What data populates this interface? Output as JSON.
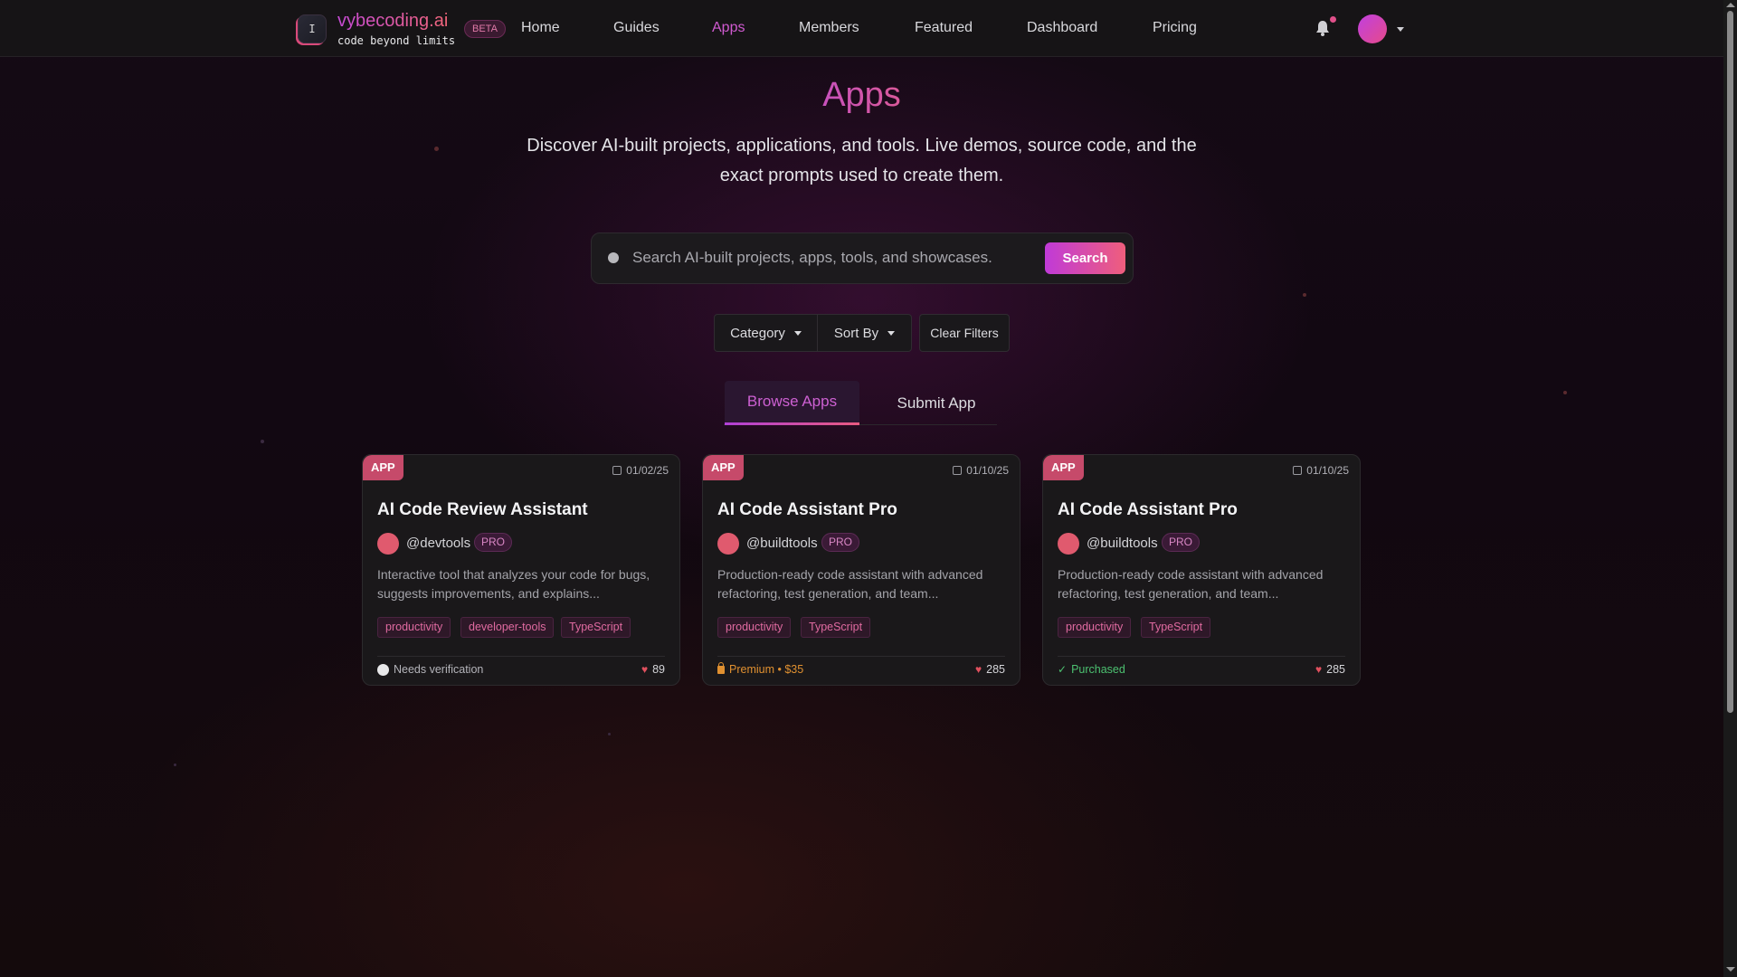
{
  "brand": {
    "name": "vybecoding.ai",
    "tagline": "code beyond limits",
    "badge": "BETA",
    "logo_glyph": "I"
  },
  "nav": {
    "links": [
      "Home",
      "Guides",
      "Apps",
      "Members",
      "Featured",
      "Dashboard",
      "Pricing"
    ],
    "active": "Apps",
    "icons": [
      "bell-icon",
      "user-avatar",
      "caret-down-icon"
    ]
  },
  "page": {
    "title": "Apps",
    "description": "Discover AI-built projects, applications, and tools. Live demos, source code, and the exact prompts used to create them."
  },
  "search": {
    "placeholder": "Search AI-built projects, apps, tools, and showcases.",
    "button": "Search"
  },
  "filters": {
    "category": "Category",
    "sort": "Sort By",
    "clear": "Clear Filters"
  },
  "tabs": {
    "browse": "Browse Apps",
    "submit": "Submit App",
    "active": "Browse Apps"
  },
  "cards": [
    {
      "badge": "APP",
      "date": "01/02/25",
      "title": "AI Code Review Assistant",
      "author": "@devtools",
      "tier": "PRO",
      "description": "Interactive tool that analyzes your code for bugs, suggests improvements, and explains...",
      "tags": [
        "productivity",
        "developer-tools",
        "TypeScript"
      ],
      "status": "Needs verification",
      "likes": "89"
    },
    {
      "badge": "APP",
      "date": "01/10/25",
      "title": "AI Code Assistant Pro",
      "author": "@buildtools",
      "tier": "PRO",
      "description": "Production-ready code assistant with advanced refactoring, test generation, and team...",
      "tags": [
        "productivity",
        "TypeScript"
      ],
      "status": "Premium • $35",
      "likes": "285"
    },
    {
      "badge": "APP",
      "date": "01/10/25",
      "title": "AI Code Assistant Pro",
      "author": "@buildtools",
      "tier": "PRO",
      "description": "Production-ready code assistant with advanced refactoring, test generation, and team...",
      "tags": [
        "productivity",
        "TypeScript"
      ],
      "status": "Purchased",
      "likes": "285"
    }
  ],
  "colors": {
    "accent_purple": "#c03ad8",
    "accent_pink": "#ef5e7c",
    "badge": "#c64a6a",
    "premium": "#e09030",
    "purchased": "#4cc070",
    "heart": "#e0505e"
  },
  "symbols": {
    "check": "✓",
    "heart": "♥"
  }
}
